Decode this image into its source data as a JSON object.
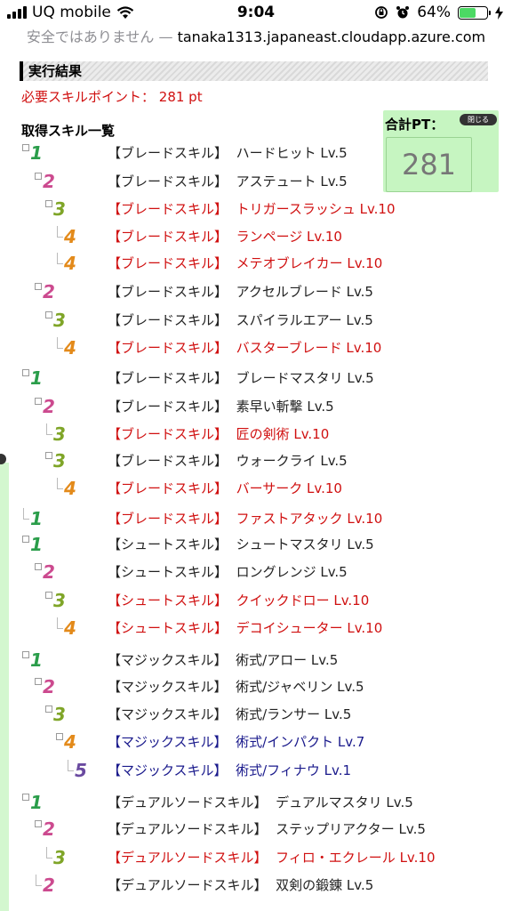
{
  "status_bar": {
    "carrier": "UQ mobile",
    "time": "9:04",
    "battery": "64%",
    "battery_level": 0.64
  },
  "url_bar": {
    "warning": "安全ではありません —",
    "host": "tanaka1313.japaneast.cloudapp.azure.com"
  },
  "result": {
    "header": "実行結果",
    "required_points": "必要スキルポイント： 281 pt",
    "list_title": "取得スキル一覧"
  },
  "total_box": {
    "label": "合計PT：",
    "close_label": "閉じる",
    "value": "281"
  },
  "colors": {
    "acquired_red": "#d01010",
    "magic_blue": "#1a1a8c",
    "total_bg": "#c6f5c1"
  },
  "skills": [
    {
      "level": "1",
      "category": "【ブレードスキル】",
      "name": "ハードヒット Lv.5",
      "color": "black"
    },
    {
      "level": "2",
      "category": "【ブレードスキル】",
      "name": "アステュート Lv.5",
      "color": "black"
    },
    {
      "level": "3",
      "category": "【ブレードスキル】",
      "name": "トリガースラッシュ Lv.10",
      "color": "red"
    },
    {
      "level": "4",
      "category": "【ブレードスキル】",
      "name": "ランページ Lv.10",
      "color": "red"
    },
    {
      "level": "4",
      "category": "【ブレードスキル】",
      "name": "メテオブレイカー Lv.10",
      "color": "red"
    },
    {
      "level": "2",
      "category": "【ブレードスキル】",
      "name": "アクセルブレード Lv.5",
      "color": "black"
    },
    {
      "level": "3",
      "category": "【ブレードスキル】",
      "name": "スパイラルエアー Lv.5",
      "color": "black"
    },
    {
      "level": "4",
      "category": "【ブレードスキル】",
      "name": "バスターブレード Lv.10",
      "color": "red"
    },
    {
      "level": "1",
      "category": "【ブレードスキル】",
      "name": "ブレードマスタリ Lv.5",
      "color": "black"
    },
    {
      "level": "2",
      "category": "【ブレードスキル】",
      "name": "素早い斬撃 Lv.5",
      "color": "black"
    },
    {
      "level": "3",
      "category": "【ブレードスキル】",
      "name": "匠の剣術 Lv.10",
      "color": "red"
    },
    {
      "level": "3",
      "category": "【ブレードスキル】",
      "name": "ウォークライ Lv.5",
      "color": "black"
    },
    {
      "level": "4",
      "category": "【ブレードスキル】",
      "name": "バーサーク Lv.10",
      "color": "red"
    },
    {
      "level": "1",
      "category": "【ブレードスキル】",
      "name": "ファストアタック Lv.10",
      "color": "red"
    },
    {
      "level": "1",
      "category": "【シュートスキル】",
      "name": "シュートマスタリ Lv.5",
      "color": "black"
    },
    {
      "level": "2",
      "category": "【シュートスキル】",
      "name": "ロングレンジ Lv.5",
      "color": "black"
    },
    {
      "level": "3",
      "category": "【シュートスキル】",
      "name": "クイックドロー Lv.10",
      "color": "red"
    },
    {
      "level": "4",
      "category": "【シュートスキル】",
      "name": "デコイシューター Lv.10",
      "color": "red"
    },
    {
      "level": "1",
      "category": "【マジックスキル】",
      "name": "術式/アロー Lv.5",
      "color": "black"
    },
    {
      "level": "2",
      "category": "【マジックスキル】",
      "name": "術式/ジャベリン Lv.5",
      "color": "black"
    },
    {
      "level": "3",
      "category": "【マジックスキル】",
      "name": "術式/ランサー Lv.5",
      "color": "black"
    },
    {
      "level": "4",
      "category": "【マジックスキル】",
      "name": "術式/インパクト Lv.7",
      "color": "blue"
    },
    {
      "level": "5",
      "category": "【マジックスキル】",
      "name": "術式/フィナウ Lv.1",
      "color": "blue"
    },
    {
      "level": "1",
      "category": "【デュアルソードスキル】",
      "name": "デュアルマスタリ Lv.5",
      "color": "black"
    },
    {
      "level": "2",
      "category": "【デュアルソードスキル】",
      "name": "ステップリアクター Lv.5",
      "color": "black"
    },
    {
      "level": "3",
      "category": "【デュアルソードスキル】",
      "name": "フィロ・エクレール Lv.10",
      "color": "red"
    },
    {
      "level": "2",
      "category": "【デュアルソードスキル】",
      "name": "双剣の鍛錬 Lv.5",
      "color": "black"
    }
  ]
}
